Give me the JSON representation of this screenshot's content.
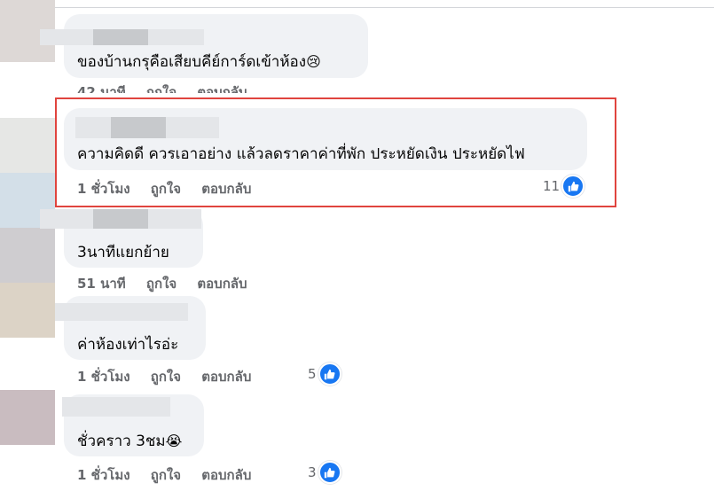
{
  "colors": {
    "bubble": "#f0f2f5",
    "text": "#050505",
    "meta": "#65676b",
    "like_blue": "#1877f2",
    "highlight": "#e0443e"
  },
  "comments": [
    {
      "text": "ของบ้านกรุคือเสียบคีย์การ์ดเข้าห้อง",
      "emoji": "😢",
      "time": "42 นาที",
      "like": "ถูกใจ",
      "reply": "ตอบกลับ",
      "reactions": ""
    },
    {
      "text": "ความคิดดี ควรเอาอย่าง แล้วลดราคาค่าที่พัก ประหยัดเงิน ประหยัดไฟ",
      "time": "1 ชั่วโมง",
      "like": "ถูกใจ",
      "reply": "ตอบกลับ",
      "reactions": "11"
    },
    {
      "text": "3นาทีแยกย้าย",
      "time": "51 นาที",
      "like": "ถูกใจ",
      "reply": "ตอบกลับ",
      "reactions": ""
    },
    {
      "text": "ค่าห้องเท่าไรอ่ะ",
      "time": "1 ชั่วโมง",
      "like": "ถูกใจ",
      "reply": "ตอบกลับ",
      "reactions": "5"
    },
    {
      "text": "ชั่วคราว 3ชม",
      "emoji": "😭",
      "time": "1 ชั่วโมง",
      "like": "ถูกใจ",
      "reply": "ตอบกลับ",
      "reactions": "3"
    }
  ],
  "icons": {
    "like": "thumbs-up-icon",
    "sad": "crying-face-icon"
  }
}
